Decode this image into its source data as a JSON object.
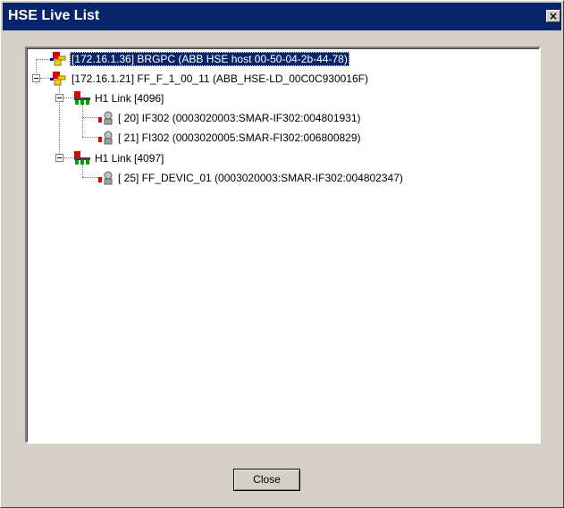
{
  "window": {
    "title": "HSE Live List",
    "close_glyph": "×"
  },
  "tree": {
    "nodes": [
      {
        "label": "[172.16.1.36] BRGPC (ABB HSE host 00-50-04-2b-44-78)",
        "icon": "hse-host-icon",
        "selected": true
      },
      {
        "label": "[172.16.1.21] FF_F_1_00_11 (ABB_HSE-LD_00C0C930016F)",
        "icon": "hse-linking-device-icon",
        "expanded": true
      },
      {
        "label": "H1 Link [4096]",
        "icon": "h1-link-icon",
        "expanded": true
      },
      {
        "label": "[ 20] IF302 (0003020003:SMAR-IF302:004801931)",
        "icon": "field-device-icon"
      },
      {
        "label": "[ 21] FI302 (0003020005:SMAR-FI302:006800829)",
        "icon": "field-device-icon"
      },
      {
        "label": "H1 Link [4097]",
        "icon": "h1-link-icon",
        "expanded": true
      },
      {
        "label": "[ 25] FF_DEVIC_01 (0003020003:SMAR-IF302:004802347)",
        "icon": "field-device-icon"
      }
    ]
  },
  "buttons": {
    "close_label": "Close"
  },
  "colors": {
    "titlebar": "#0a246a",
    "dialog_face": "#d4d0c8",
    "selection": "#0a246a",
    "icon_red": "#e00000"
  }
}
